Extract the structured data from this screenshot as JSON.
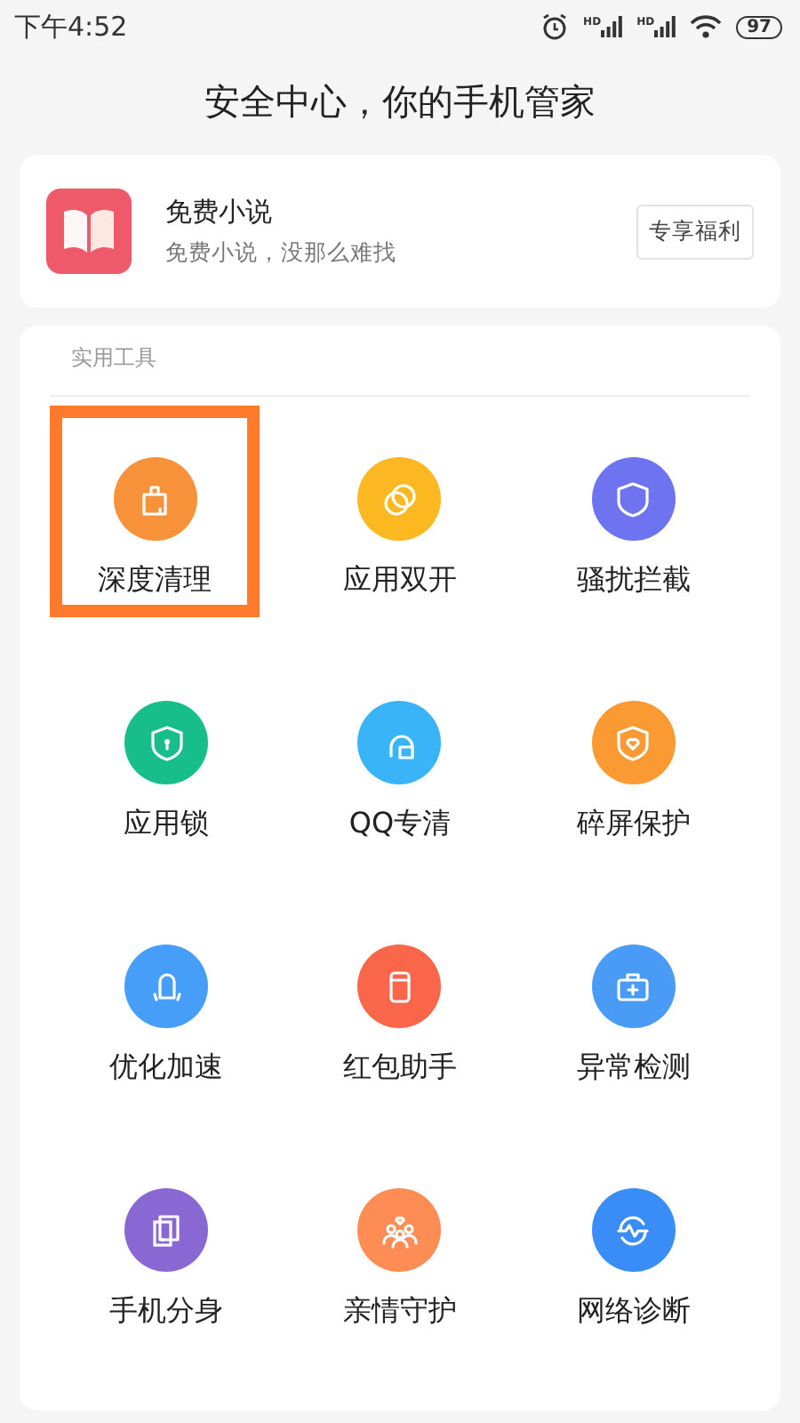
{
  "status_bar": {
    "time": "下午4:52",
    "signal_labels": [
      "HD",
      "HD"
    ],
    "battery": "97"
  },
  "title": "安全中心，你的手机管家",
  "banner": {
    "title": "免费小说",
    "subtitle": "免费小说，没那么难找",
    "button": "专享福利"
  },
  "tools": {
    "heading": "实用工具",
    "items": [
      {
        "label": "深度清理",
        "color": "#f7923a",
        "highlighted": true
      },
      {
        "label": "应用双开",
        "color": "#fbb820",
        "highlighted": false
      },
      {
        "label": "骚扰拦截",
        "color": "#6e74ef",
        "highlighted": false
      },
      {
        "label": "应用锁",
        "color": "#17be8a",
        "highlighted": false
      },
      {
        "label": "QQ专清",
        "color": "#3ab4f8",
        "highlighted": false
      },
      {
        "label": "碎屏保护",
        "color": "#fb9a32",
        "highlighted": false
      },
      {
        "label": "优化加速",
        "color": "#479ef8",
        "highlighted": false
      },
      {
        "label": "红包助手",
        "color": "#f9664a",
        "highlighted": false
      },
      {
        "label": "异常检测",
        "color": "#4a9bf6",
        "highlighted": false
      },
      {
        "label": "手机分身",
        "color": "#8a68d4",
        "highlighted": false
      },
      {
        "label": "亲情守护",
        "color": "#fd8d55",
        "highlighted": false
      },
      {
        "label": "网络诊断",
        "color": "#3a8cf6",
        "highlighted": false
      }
    ]
  }
}
